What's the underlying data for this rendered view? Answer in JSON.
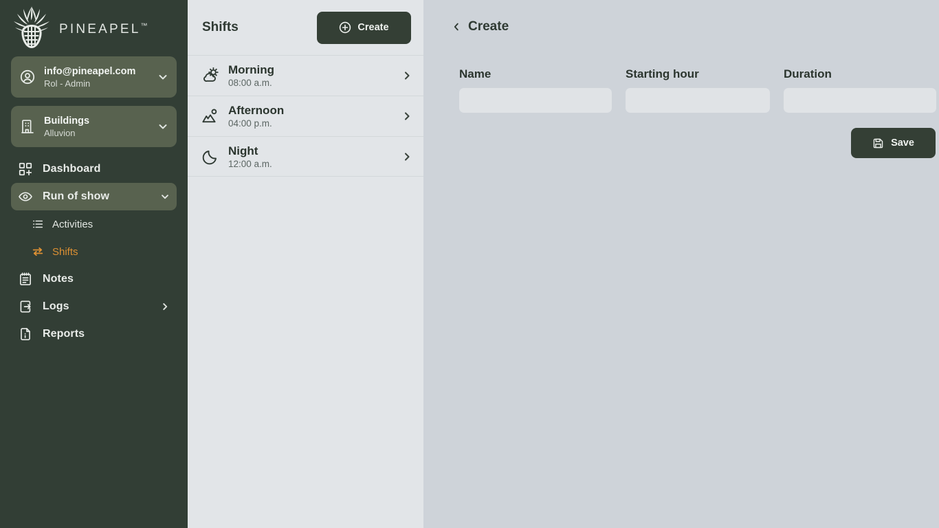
{
  "brand": {
    "name": "PINEAPEL",
    "trademark": "™",
    "logo_icon": "pineapple-icon"
  },
  "sidebar": {
    "account": {
      "icon": "user-circle-icon",
      "email": "info@pineapel.com",
      "role": "Rol - Admin",
      "chevron": "chevron-down-icon"
    },
    "building": {
      "icon": "building-icon",
      "label": "Buildings",
      "value": "Alluvion",
      "chevron": "chevron-down-icon"
    },
    "items": [
      {
        "label": "Dashboard",
        "icon": "dashboard-grid-plus-icon",
        "active": false,
        "tail": ""
      },
      {
        "label": "Run of show",
        "icon": "eye-icon",
        "active": true,
        "tail": "chevron-down-icon"
      },
      {
        "label": "Notes",
        "icon": "notepad-icon",
        "active": false,
        "tail": ""
      },
      {
        "label": "Logs",
        "icon": "file-export-icon",
        "active": false,
        "tail": "chevron-right-icon"
      },
      {
        "label": "Reports",
        "icon": "file-info-icon",
        "active": false,
        "tail": ""
      }
    ],
    "subitems": [
      {
        "label": "Activities",
        "icon": "list-icon",
        "current": false
      },
      {
        "label": "Shifts",
        "icon": "shift-arrows-icon",
        "current": true
      }
    ]
  },
  "list_panel": {
    "title": "Shifts",
    "create_button": {
      "label": "Create",
      "icon": "plus-circle-icon"
    },
    "shifts": [
      {
        "name": "Morning",
        "hour": "08:00 a.m.",
        "icon": "sun-cloud-icon",
        "chevron": "chevron-right-icon"
      },
      {
        "name": "Afternoon",
        "hour": "04:00 p.m.",
        "icon": "sunset-icon",
        "chevron": "chevron-right-icon"
      },
      {
        "name": "Night",
        "hour": "12:00 a.m.",
        "icon": "moon-icon",
        "chevron": "chevron-right-icon"
      }
    ]
  },
  "detail_panel": {
    "back_icon": "chevron-left-icon",
    "title": "Create",
    "fields": {
      "name": {
        "label": "Name",
        "value": "",
        "placeholder": ""
      },
      "start": {
        "label": "Starting hour",
        "value": "",
        "placeholder": ""
      },
      "duration": {
        "label": "Duration",
        "value": "",
        "placeholder": ""
      }
    },
    "save_button": {
      "label": "Save",
      "icon": "floppy-save-icon"
    }
  },
  "colors": {
    "sidebar_bg": "#323e35",
    "sidebar_raised": "#58624f",
    "accent_orange": "#dd9033",
    "list_bg": "#e2e5e8",
    "detail_bg": "#ced3d9",
    "button_dark": "#343f35",
    "input_bg": "#e0e3e6"
  }
}
